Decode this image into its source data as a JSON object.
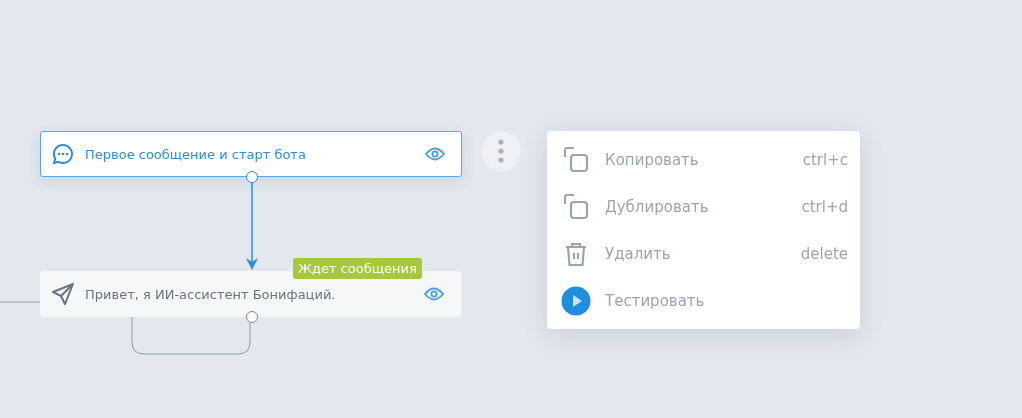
{
  "nodes": [
    {
      "kind": "message",
      "title": "Первое сообщение и старт бота",
      "selected": true
    },
    {
      "kind": "send",
      "title": "Привет, я ИИ-ассистент Бонифаций.",
      "selected": false,
      "badge": "Ждет сообщения"
    }
  ],
  "context_menu": {
    "items": [
      {
        "kind": "copy",
        "label": "Копировать",
        "shortcut": "ctrl+c"
      },
      {
        "kind": "duplicate",
        "label": "Дублировать",
        "shortcut": "ctrl+d"
      },
      {
        "kind": "delete",
        "label": "Удалить",
        "shortcut": "delete"
      },
      {
        "kind": "test",
        "label": "Тестировать"
      }
    ]
  }
}
